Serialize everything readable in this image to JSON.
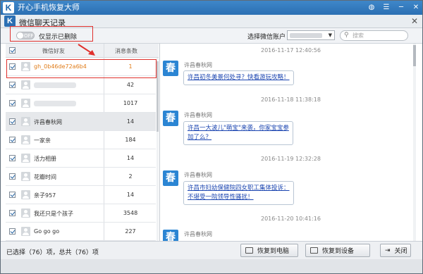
{
  "app": {
    "title": "开心手机恢复大师",
    "logo": "K"
  },
  "subwindow": {
    "title": "微信聊天记录",
    "logo": "K"
  },
  "options": {
    "toggle_text": "OFF",
    "only_deleted_label": "仅显示已删除",
    "account_label": "选择微信账户",
    "search_placeholder": "搜索"
  },
  "list": {
    "col_friend": "微信好友",
    "col_count": "消息条数",
    "rows": [
      {
        "name": "gh_0b46de72a6b4",
        "count": "1"
      },
      {
        "name": "",
        "count": "42"
      },
      {
        "name": "",
        "count": "1017"
      },
      {
        "name": "许昌春秋网",
        "count": "14"
      },
      {
        "name": "一家亲",
        "count": "184"
      },
      {
        "name": "活力相册",
        "count": "14"
      },
      {
        "name": "花瓣时间",
        "count": "2"
      },
      {
        "name": "亲子957",
        "count": "14"
      },
      {
        "name": "我还只是个孩子",
        "count": "3548"
      },
      {
        "name": "Go go go",
        "count": "227"
      }
    ]
  },
  "messages": [
    {
      "time": "2016-11-17 12:40:56",
      "sender": "许昌春秋网",
      "lines": [
        "许昌初冬美景何处寻？快看游玩攻略！"
      ]
    },
    {
      "time": "2016-11-18 11:38:18",
      "sender": "许昌春秋网",
      "lines": [
        "许昌一大波儿\"萌宝\"来袭，你家宝宝参",
        "加了么？"
      ]
    },
    {
      "time": "2016-11-19 12:32:28",
      "sender": "许昌春秋网",
      "lines": [
        "许昌市妇幼保健院四女职工集体投诉：",
        "不堪受一院领导性骚扰！"
      ]
    },
    {
      "time": "2016-11-20 10:41:16",
      "sender": "许昌春秋网",
      "lines": []
    }
  ],
  "bottom": {
    "status": "已选择（76）项，总共（76）项",
    "restore_pc": "恢复到电脑",
    "restore_device": "恢复到设备",
    "close": "关闭"
  },
  "colors": {
    "title_blue": "#2b6fb3",
    "highlight_orange": "#e07b18",
    "annotation_red": "#e0302c",
    "link_blue": "#1a44b0"
  }
}
